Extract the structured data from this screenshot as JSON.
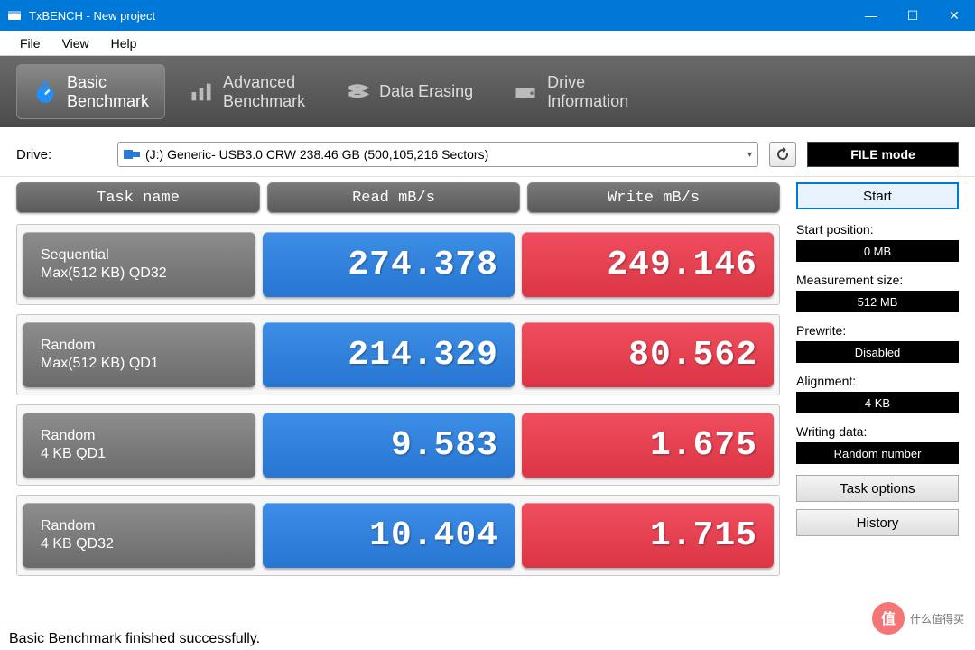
{
  "window": {
    "app": "TxBENCH",
    "title": "TxBENCH - New project"
  },
  "menu": {
    "file": "File",
    "view": "View",
    "help": "Help"
  },
  "tabs": {
    "basic": {
      "l1": "Basic",
      "l2": "Benchmark"
    },
    "advanced": {
      "l1": "Advanced",
      "l2": "Benchmark"
    },
    "erase": {
      "l1": "Data Erasing"
    },
    "info": {
      "l1": "Drive",
      "l2": "Information"
    }
  },
  "drive": {
    "label": "Drive:",
    "selected": "(J:) Generic- USB3.0 CRW  238.46 GB (500,105,216 Sectors)",
    "filemode": "FILE mode"
  },
  "headers": {
    "task": "Task name",
    "read": "Read mB/s",
    "write": "Write mB/s"
  },
  "rows": [
    {
      "t1": "Sequential",
      "t2": "Max(512 KB) QD32",
      "read": "274.378",
      "write": "249.146"
    },
    {
      "t1": "Random",
      "t2": "Max(512 KB) QD1",
      "read": "214.329",
      "write": "80.562"
    },
    {
      "t1": "Random",
      "t2": "4 KB QD1",
      "read": "9.583",
      "write": "1.675"
    },
    {
      "t1": "Random",
      "t2": "4 KB QD32",
      "read": "10.404",
      "write": "1.715"
    }
  ],
  "side": {
    "start": "Start",
    "start_pos": {
      "label": "Start position:",
      "value": "0 MB"
    },
    "meas_size": {
      "label": "Measurement size:",
      "value": "512 MB"
    },
    "prewrite": {
      "label": "Prewrite:",
      "value": "Disabled"
    },
    "alignment": {
      "label": "Alignment:",
      "value": "4 KB"
    },
    "writingdata": {
      "label": "Writing data:",
      "value": "Random number"
    },
    "task_options": "Task options",
    "history": "History"
  },
  "status": "Basic Benchmark finished successfully.",
  "watermark": "什么值得买"
}
